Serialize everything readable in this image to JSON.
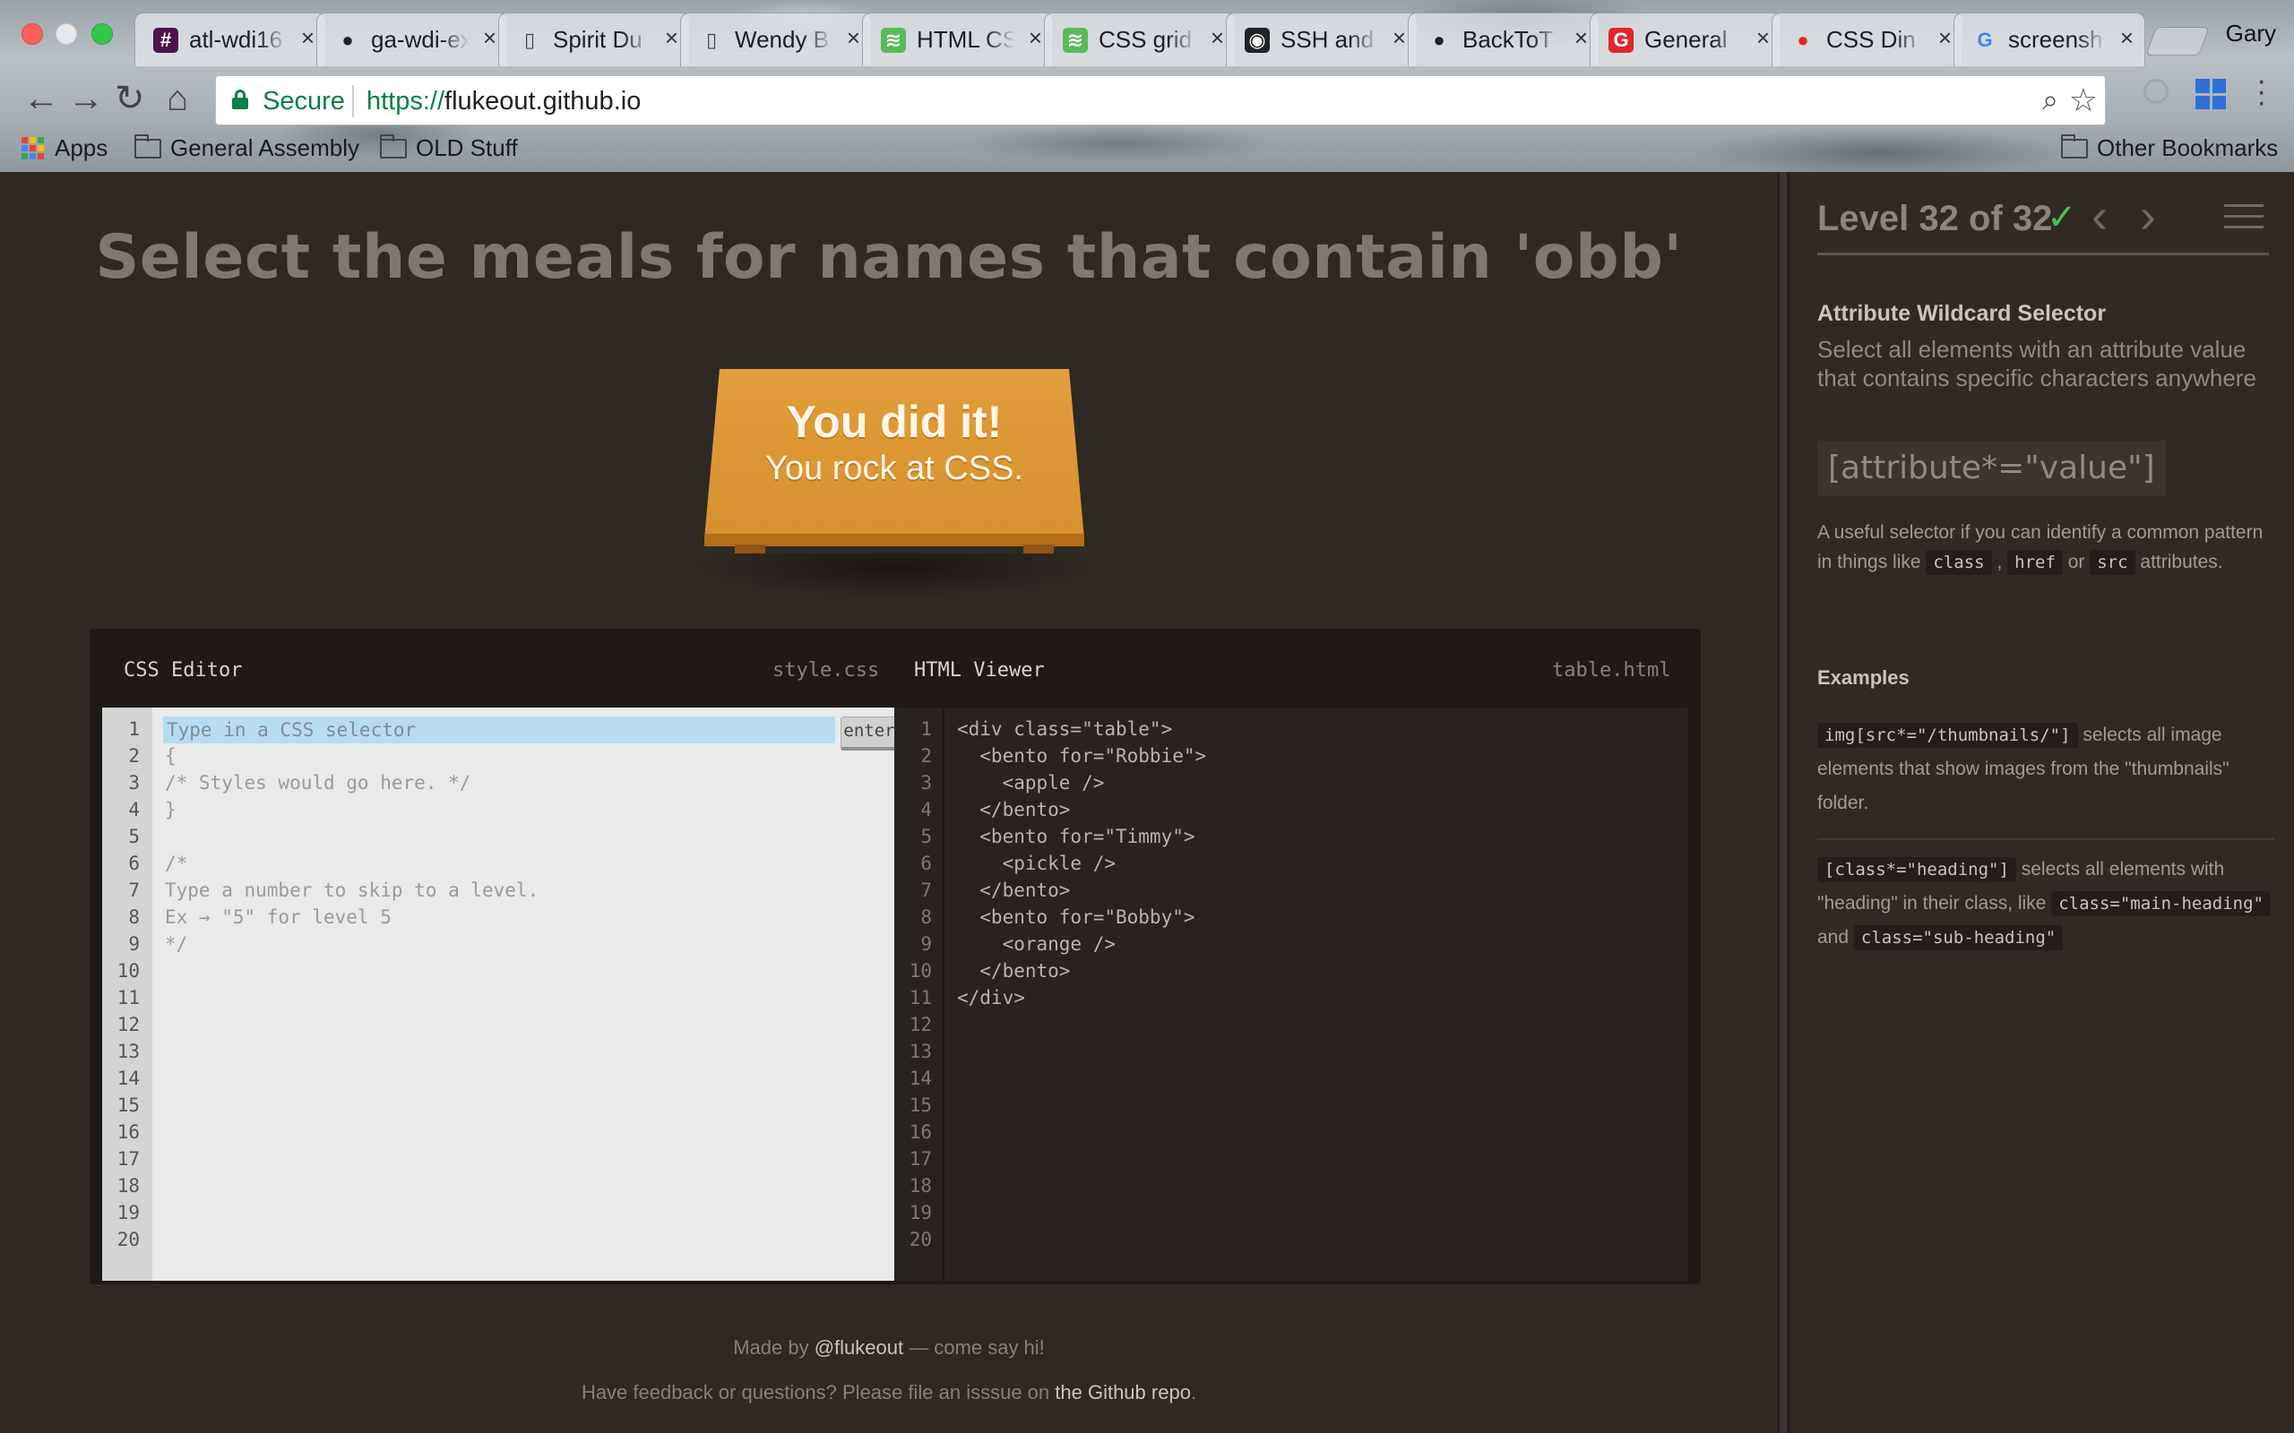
{
  "browser": {
    "tabs": [
      {
        "label": "atl-wdi16",
        "icon": "slack-icon"
      },
      {
        "label": "ga-wdi-ex",
        "icon": "github-icon"
      },
      {
        "label": "Spirit Du",
        "icon": "page-icon"
      },
      {
        "label": "Wendy B",
        "icon": "page-icon"
      },
      {
        "label": "HTML CS",
        "icon": "green-code-icon"
      },
      {
        "label": "CSS grid",
        "icon": "green-code-icon"
      },
      {
        "label": "SSH and",
        "icon": "github-box-icon"
      },
      {
        "label": "BackToT",
        "icon": "github-icon"
      },
      {
        "label": "General",
        "icon": "ga-icon"
      },
      {
        "label": "CSS Din",
        "icon": "red-dot-icon"
      },
      {
        "label": "screensh",
        "icon": "google-icon"
      }
    ],
    "profile_name": "Gary",
    "omnibox": {
      "secure_label": "Secure",
      "url_scheme": "https://",
      "url_host": "flukeout.github.io"
    },
    "bookmarks": {
      "apps": "Apps",
      "general_assembly": "General Assembly",
      "old_stuff": "OLD Stuff",
      "other": "Other Bookmarks"
    }
  },
  "game": {
    "order": "Select the meals for names that contain 'obb'",
    "win_title": "You did it!",
    "win_sub": "You rock at CSS.",
    "css_editor": {
      "title": "CSS Editor",
      "file": "style.css",
      "placeholder": "Type in a CSS selector",
      "enter_label": "enter",
      "lines": [
        "",
        "{",
        "/* Styles would go here. */",
        "}",
        "",
        "/*",
        "Type a number to skip to a level.",
        "Ex → \"5\" for level 5",
        "*/",
        "",
        "",
        "",
        "",
        "",
        "",
        "",
        "",
        "",
        "",
        ""
      ]
    },
    "html_viewer": {
      "title": "HTML Viewer",
      "file": "table.html",
      "lines": [
        "<div class=\"table\">",
        "  <bento for=\"Robbie\">",
        "    <apple />",
        "  </bento>",
        "  <bento for=\"Timmy\">",
        "    <pickle />",
        "  </bento>",
        "  <bento for=\"Bobby\">",
        "    <orange />",
        "  </bento>",
        "</div>",
        "",
        "",
        "",
        "",
        "",
        "",
        "",
        "",
        ""
      ]
    },
    "line_numbers": [
      "1",
      "2",
      "3",
      "4",
      "5",
      "6",
      "7",
      "8",
      "9",
      "10",
      "11",
      "12",
      "13",
      "14",
      "15",
      "16",
      "17",
      "18",
      "19",
      "20"
    ],
    "footer": {
      "made_by": "Made by ",
      "author": "@flukeout",
      "made_by_tail": " — come say hi!",
      "feedback": "Have feedback or questions? Please file an isssue on ",
      "repo": "the Github repo",
      "feedback_tail": "."
    }
  },
  "sidebar": {
    "level_title": "Level 32 of 32",
    "check": "✓",
    "prev": "‹",
    "next": "›",
    "selector_name": "Attribute Wildcard Selector",
    "title": "Select all elements with an attribute value that contains specific characters anywhere",
    "syntax": "[attribute*=\"value\"]",
    "hint_pre": "A useful selector if you can identify a common pattern in things like ",
    "hint_class": "class",
    "hint_comma": " , ",
    "hint_href": "href",
    "hint_or": " or ",
    "hint_src": "src",
    "hint_post": " attributes.",
    "examples_title": "Examples",
    "ex1_code": "img[src*=\"/thumbnails/\"]",
    "ex1_text": " selects all image elements that show images from the \"thumbnails\" folder.",
    "ex2_code": "[class*=\"heading\"]",
    "ex2_text_a": " selects all elements with \"heading\" in their class, like ",
    "ex2_code_b": "class=\"main-heading\"",
    "ex2_text_b": " and ",
    "ex2_code_c": "class=\"sub-heading\""
  },
  "colors": {
    "background": "#2f2a24",
    "table": "#e19e3b",
    "accent_check": "#4cbb55",
    "secure_green": "#0b8043"
  }
}
